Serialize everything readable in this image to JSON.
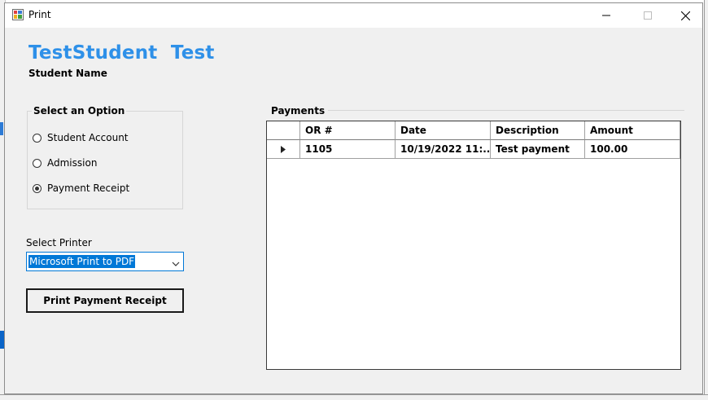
{
  "window": {
    "title": "Print",
    "controls": {
      "minimize": "minimize",
      "maximize": "maximize",
      "close": "close"
    }
  },
  "student": {
    "name": "TestStudent  Test",
    "name_label": "Student Name"
  },
  "options": {
    "title": "Select an Option",
    "items": [
      {
        "label": "Student Account",
        "selected": false
      },
      {
        "label": "Admission",
        "selected": false
      },
      {
        "label": "Payment Receipt",
        "selected": true
      }
    ]
  },
  "printer": {
    "label": "Select Printer",
    "selected": "Microsoft Print to PDF"
  },
  "print_button": {
    "label": "Print Payment Receipt"
  },
  "payments": {
    "title": "Payments",
    "columns": [
      "OR #",
      "Date",
      "Description",
      "Amount"
    ],
    "rows": [
      {
        "or": "1105",
        "date": "10/19/2022 11:...",
        "description": "Test payment",
        "amount": "100.00"
      }
    ]
  },
  "colors": {
    "accent": "#2e90e8",
    "selection": "#0078d7",
    "window_bg": "#f0f0f0"
  }
}
